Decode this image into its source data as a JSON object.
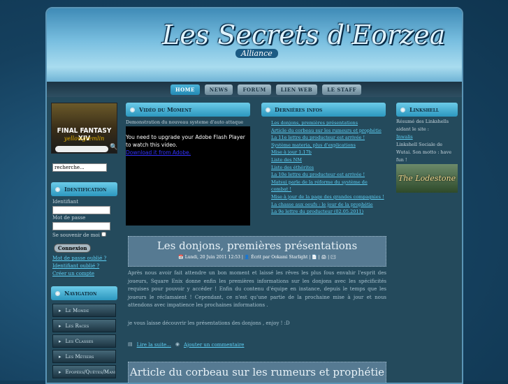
{
  "header": {
    "logo_text": "Les Secrets d'Eorzea",
    "logo_sub": "Alliance"
  },
  "nav": {
    "tabs": [
      "HOME",
      "NEWS",
      "FORUM",
      "LIEN WEB",
      "LE STAFF"
    ]
  },
  "left": {
    "banner_text": "FINAL FANTASY XIV",
    "banner_sub": "yellowgremlin",
    "search_value": "recherche...",
    "login": {
      "title": "Identification",
      "username_label": "Identifiant",
      "password_label": "Mot de passe",
      "remember_label": "Se souvenir de moi",
      "submit": "Connexion",
      "links": [
        "Mot de passe oublié ?",
        "Identifiant oublié ?",
        "Créer un compte"
      ]
    },
    "navigation": {
      "title": "Navigation",
      "items": [
        "Le Monde",
        "Les Races",
        "Les Classes",
        "Les Métiers",
        "Epopées/Quêtes/Mandats"
      ]
    }
  },
  "video": {
    "title": "Vidéo du Moment",
    "caption": "Demonstration du nouveau systeme d'auto attaque",
    "flash_msg": "You need to upgrade your Adobe Flash Player to watch this video.",
    "flash_link": "Download it from Adobe."
  },
  "latest": {
    "title": "Dernières infos",
    "items": [
      "Les donjons, premières présentations",
      "Article du corbeau sur les rumeurs et prophétie",
      "La 11e lettre du producteur est arrivée !",
      "Système materia, plus d'explications",
      "Mise à jour 1.17b",
      "Liste des NM",
      "Liste des éthérites",
      "La 10e lettre du producteur est arrivée !",
      "Matsui parle de la réforme du système de combat !",
      "Mise à jour de la page des grandes compagnies !",
      "La chasse aux oeufs : le jour de la prophétie",
      "La 9e lettre du producteur (02.05.2011)"
    ]
  },
  "linkshell": {
    "title": "Linkshell",
    "intro": "Résumé des Linkshells aidant le site :",
    "link": "Inwalis",
    "desc": "Linkshell Sociale de Wutai. Son motto : have fun !",
    "banner_text": "The Lodestone"
  },
  "article": {
    "title": "Les donjons, premières présentations",
    "date": "Lundi, 20 Juin 2011 12:53",
    "author": "Écrit par Ookami Starlight",
    "p1": "Après nous avoir fait attendre un bon moment et laissé les rêves les plus fous envahir l'esprit des joueurs, Square Enix donne enfin les premières informations sur les donjons avec les spécificités requises pour pouvoir y accéder ! Enfin du contenu d'équipe en instance, depuis le temps que les joueurs le réclamaient ! Cependant, ce n'est qu'une partie de la prochaine mise à jour et nous attendons avec impatience les prochaines informations .",
    "p2": "je vous laisse découvrir les présentations des donjons , enjoy ! :D",
    "read_more": "Lire la suite...",
    "comment": "Ajouter un commentaire"
  },
  "article2": {
    "title": "Article du corbeau sur les rumeurs et prophétie"
  }
}
